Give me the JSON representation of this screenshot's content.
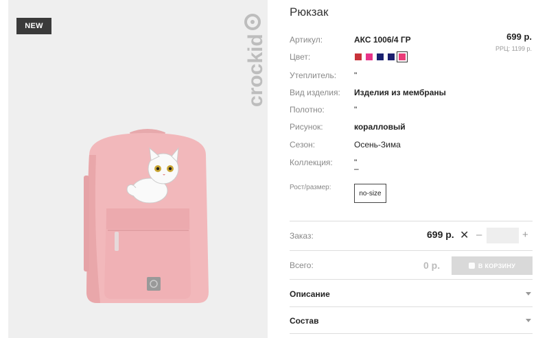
{
  "badge": {
    "new": "NEW"
  },
  "brand": {
    "logo_text": "crockid"
  },
  "product": {
    "title": "Рюкзак",
    "price": "699 р.",
    "rrp": "РРЦ: 1199 р."
  },
  "specs": [
    {
      "label": "Артикул:",
      "value": "АКС 1006/4 ГР"
    },
    {
      "label": "Цвет:",
      "value": ""
    },
    {
      "label": "Утеплитель:",
      "value": "\""
    },
    {
      "label": "Вид изделия:",
      "value": "Изделия из мембраны"
    },
    {
      "label": "Полотно:",
      "value": "\""
    },
    {
      "label": "Рисунок:",
      "value": "коралловый"
    },
    {
      "label": "Сезон:",
      "value": "Осень-Зима"
    },
    {
      "label": "Коллекция:",
      "value": "\"",
      "value2": "–"
    },
    {
      "label": "Рост/размер:",
      "value": "no-size"
    }
  ],
  "colors": [
    "#c8323a",
    "#e8348a",
    "#1a2170",
    "#1c1f6e",
    "#ea3c78"
  ],
  "order": {
    "label": "Заказ:",
    "price": "699 р.",
    "times": "✕",
    "minus": "–",
    "plus": "+",
    "qty": ""
  },
  "total": {
    "label": "Всего:",
    "price": "0 р.",
    "cart_button": "В КОРЗИНУ"
  },
  "accordion": [
    {
      "title": "Описание"
    },
    {
      "title": "Состав"
    }
  ]
}
